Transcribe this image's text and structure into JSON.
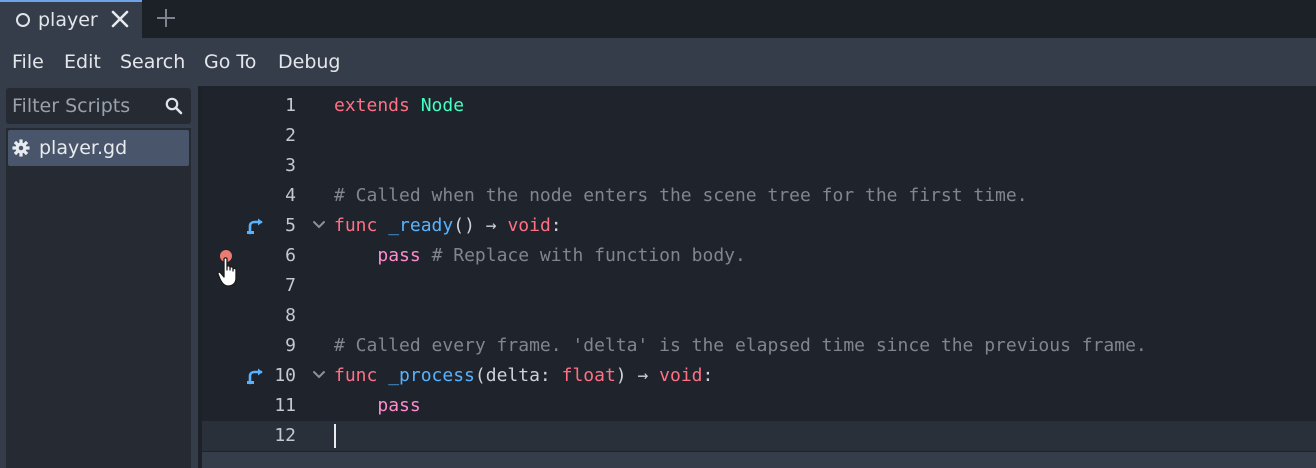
{
  "tab": {
    "label": "player"
  },
  "menu": [
    "File",
    "Edit",
    "Search",
    "Go To",
    "Debug"
  ],
  "sidebar": {
    "filter_placeholder": "Filter Scripts",
    "scripts": [
      "player.gd"
    ]
  },
  "editor": {
    "lines": [
      {
        "num": "1",
        "parts": [
          {
            "t": "extends",
            "c": "kw"
          },
          {
            "t": " ",
            "c": "plain"
          },
          {
            "t": "Node",
            "c": "type"
          }
        ]
      },
      {
        "num": "2",
        "parts": []
      },
      {
        "num": "3",
        "parts": []
      },
      {
        "num": "4",
        "parts": [
          {
            "t": "# Called when the node enters the scene tree for the first time.",
            "c": "cmt"
          }
        ]
      },
      {
        "num": "5",
        "override": true,
        "fold": true,
        "parts": [
          {
            "t": "func",
            "c": "kw"
          },
          {
            "t": " ",
            "c": "plain"
          },
          {
            "t": "_ready",
            "c": "fn"
          },
          {
            "t": "() ",
            "c": "plain"
          },
          {
            "t": "→",
            "c": "plain"
          },
          {
            "t": " ",
            "c": "plain"
          },
          {
            "t": "void",
            "c": "kw"
          },
          {
            "t": ":",
            "c": "plain"
          }
        ]
      },
      {
        "num": "6",
        "breakpoint": true,
        "parts": [
          {
            "t": "    ",
            "c": "plain"
          },
          {
            "t": "pass",
            "c": "pass"
          },
          {
            "t": " ",
            "c": "plain"
          },
          {
            "t": "# Replace with function body.",
            "c": "cmt"
          }
        ]
      },
      {
        "num": "7",
        "parts": []
      },
      {
        "num": "8",
        "parts": []
      },
      {
        "num": "9",
        "parts": [
          {
            "t": "# Called every frame. 'delta' is the elapsed time since the previous frame.",
            "c": "cmt"
          }
        ]
      },
      {
        "num": "10",
        "override": true,
        "fold": true,
        "parts": [
          {
            "t": "func",
            "c": "kw"
          },
          {
            "t": " ",
            "c": "plain"
          },
          {
            "t": "_process",
            "c": "fn"
          },
          {
            "t": "(delta: ",
            "c": "plain"
          },
          {
            "t": "float",
            "c": "kw"
          },
          {
            "t": ") ",
            "c": "plain"
          },
          {
            "t": "→",
            "c": "plain"
          },
          {
            "t": " ",
            "c": "plain"
          },
          {
            "t": "void",
            "c": "kw"
          },
          {
            "t": ":",
            "c": "plain"
          }
        ]
      },
      {
        "num": "11",
        "parts": [
          {
            "t": "    ",
            "c": "plain"
          },
          {
            "t": "pass",
            "c": "pass"
          }
        ]
      },
      {
        "num": "12",
        "current": true,
        "caret": true,
        "parts": []
      }
    ]
  },
  "colors": {
    "accent": "#6ea3e8",
    "keyword": "#ff7085",
    "type": "#42ffc2",
    "function": "#57b3ff",
    "comment": "#80868f",
    "breakpoint": "#ec7b72"
  }
}
